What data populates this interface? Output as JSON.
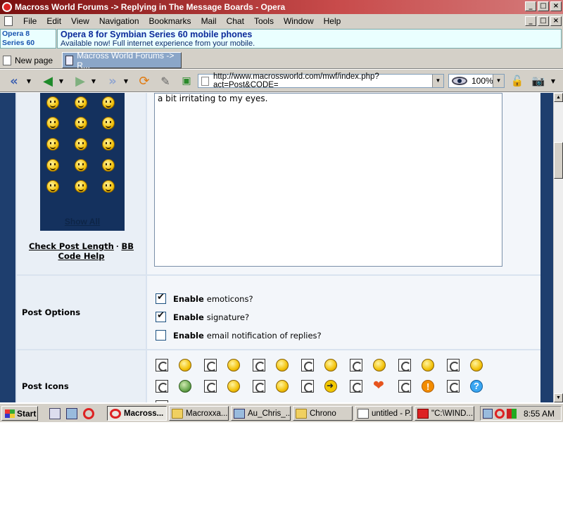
{
  "window": {
    "title": "Macross World Forums -> Replying in The Message Boards - Opera"
  },
  "menu": {
    "items": [
      "File",
      "Edit",
      "View",
      "Navigation",
      "Bookmarks",
      "Mail",
      "Chat",
      "Tools",
      "Window",
      "Help"
    ]
  },
  "ad": {
    "left_line1": "Opera 8",
    "left_line2": "Series 60",
    "title": "Opera 8 for Symbian Series 60 mobile phones",
    "subtitle": "Available now! Full internet experience from your mobile."
  },
  "tabs": [
    {
      "label": "New page",
      "active": false
    },
    {
      "label": "Macross World Forums -> R...",
      "active": true
    }
  ],
  "toolbar": {
    "address": "http://www.macrossworld.com/mwf/index.php?act=Post&CODE=",
    "zoom": "100%"
  },
  "editor": {
    "show_all": "Show All",
    "check_length": "Check Post Length",
    "separator": "·",
    "bb": "BB",
    "code_help": "Code Help",
    "text": "a bit irritating to my eyes."
  },
  "post_options": {
    "label": "Post Options",
    "items": [
      {
        "bold": "Enable",
        "rest": "emoticons?",
        "checked": true
      },
      {
        "bold": "Enable",
        "rest": "signature?",
        "checked": true
      },
      {
        "bold": "Enable",
        "rest": "email notification of replies?",
        "checked": false
      }
    ]
  },
  "post_icons": {
    "label": "Post Icons"
  },
  "taskbar": {
    "start": "Start",
    "tasks": [
      {
        "label": "Macross...",
        "icon": "opera-icon",
        "active": true
      },
      {
        "label": "Macroxxa...",
        "icon": "folder-icon",
        "active": false
      },
      {
        "label": "Au_Chris_...",
        "icon": "network-icon",
        "active": false
      },
      {
        "label": "Chrono",
        "icon": "folder-icon",
        "active": false
      },
      {
        "label": "untitled - P...",
        "icon": "paint-icon",
        "active": false
      },
      {
        "label": "\"C:\\WIND...",
        "icon": "media-icon",
        "active": false
      }
    ],
    "clock": "8:55 AM"
  },
  "colors": {
    "titlebar": "#7a1010",
    "page_bg": "#1e3e6e",
    "ad_text": "#0b2a9a",
    "active_tab": "#8ba6c8"
  }
}
